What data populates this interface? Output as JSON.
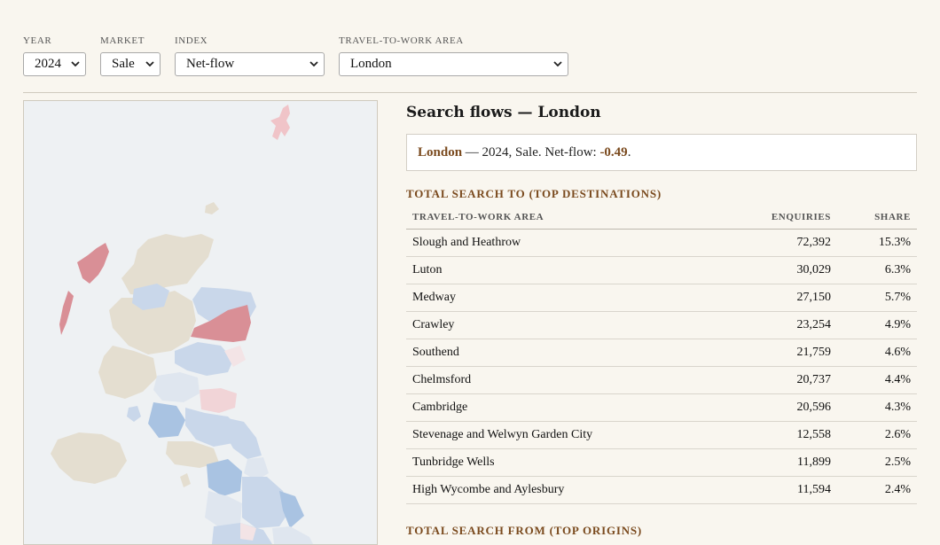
{
  "filters": {
    "year": {
      "label": "YEAR",
      "value": "2024"
    },
    "market": {
      "label": "MARKET",
      "value": "Sale"
    },
    "index": {
      "label": "INDEX",
      "value": "Net-flow"
    },
    "ttwa": {
      "label": "TRAVEL-TO-WORK AREA",
      "value": "London"
    }
  },
  "panel": {
    "title": "Search flows — London",
    "summary": {
      "place": "London",
      "text": " — 2024, Sale. Net-flow: ",
      "value": "-0.49",
      "end": "."
    },
    "top_destinations": {
      "heading": "TOTAL SEARCH TO (TOP DESTINATIONS)",
      "columns": [
        "TRAVEL-TO-WORK AREA",
        "ENQUIRIES",
        "SHARE"
      ],
      "rows": [
        {
          "area": "Slough and Heathrow",
          "enquiries": "72,392",
          "share": "15.3%"
        },
        {
          "area": "Luton",
          "enquiries": "30,029",
          "share": "6.3%"
        },
        {
          "area": "Medway",
          "enquiries": "27,150",
          "share": "5.7%"
        },
        {
          "area": "Crawley",
          "enquiries": "23,254",
          "share": "4.9%"
        },
        {
          "area": "Southend",
          "enquiries": "21,759",
          "share": "4.6%"
        },
        {
          "area": "Chelmsford",
          "enquiries": "20,737",
          "share": "4.4%"
        },
        {
          "area": "Cambridge",
          "enquiries": "20,596",
          "share": "4.3%"
        },
        {
          "area": "Stevenage and Welwyn Garden City",
          "enquiries": "12,558",
          "share": "2.6%"
        },
        {
          "area": "Tunbridge Wells",
          "enquiries": "11,899",
          "share": "2.5%"
        },
        {
          "area": "High Wycombe and Aylesbury",
          "enquiries": "11,594",
          "share": "2.4%"
        }
      ]
    },
    "top_origins": {
      "heading": "TOTAL SEARCH FROM (TOP ORIGINS)"
    }
  },
  "colors": {
    "accent": "#7a4a1e",
    "map_neutral": "#e4ded0",
    "map_negative": "#d98f96",
    "map_positive": "#a9c3e2",
    "map_water": "#eef1f3"
  }
}
